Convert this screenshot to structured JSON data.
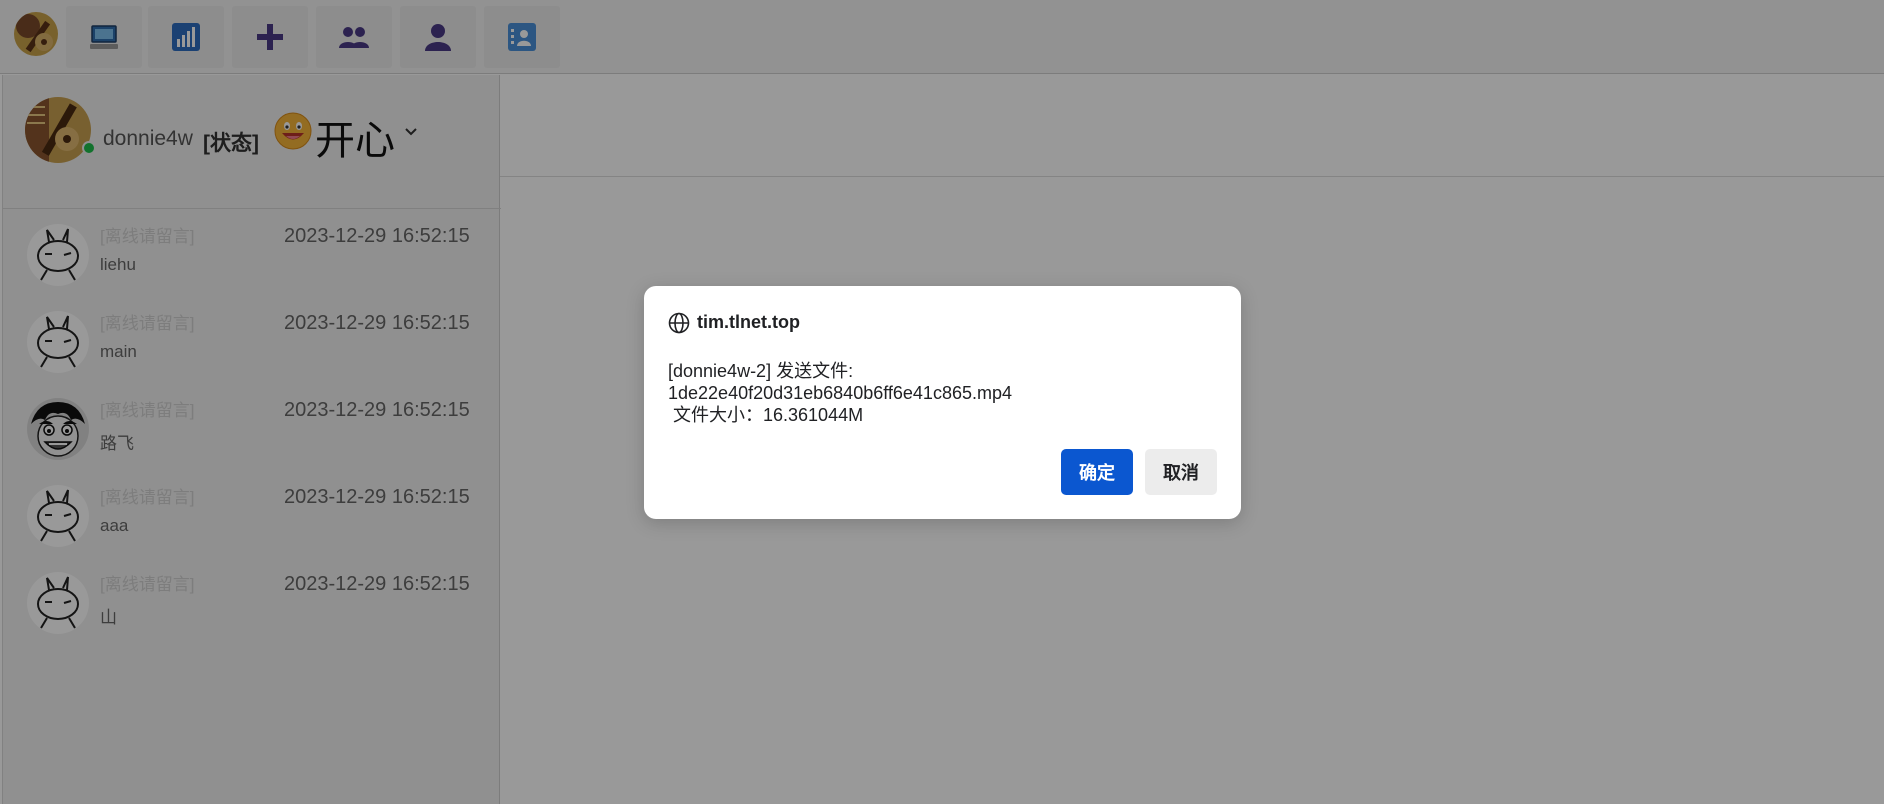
{
  "toolbar": {
    "buttons": [
      {
        "icon": "computer-icon"
      },
      {
        "icon": "bar-chart-icon"
      },
      {
        "icon": "plus-icon"
      },
      {
        "icon": "group-icon"
      },
      {
        "icon": "user-icon"
      },
      {
        "icon": "contact-card-icon"
      }
    ],
    "icon_color": "#4a3a86"
  },
  "profile": {
    "username": "donnie4w",
    "status_label": "[状态]",
    "mood": "开心",
    "online_color": "#1fbf4b"
  },
  "chats": [
    {
      "hint": "[离线请留言]",
      "name": "liehu",
      "time": "2023-12-29 16:52:15",
      "avatar": "rabbit-avatar"
    },
    {
      "hint": "[离线请留言]",
      "name": "main",
      "time": "2023-12-29 16:52:15",
      "avatar": "rabbit-avatar"
    },
    {
      "hint": "[离线请留言]",
      "name": "路飞",
      "time": "2023-12-29 16:52:15",
      "avatar": "luffy-avatar"
    },
    {
      "hint": "[离线请留言]",
      "name": "aaa",
      "time": "2023-12-29 16:52:15",
      "avatar": "rabbit-avatar"
    },
    {
      "hint": "[离线请留言]",
      "name": "山",
      "time": "2023-12-29 16:52:15",
      "avatar": "rabbit-avatar"
    }
  ],
  "dialog": {
    "origin": "tim.tlnet.top",
    "message_lines": [
      "[donnie4w-2] 发送文件:",
      "1de22e40f20d31eb6840b6ff6e41c865.mp4",
      " 文件大小：16.361044M"
    ],
    "ok_label": "确定",
    "cancel_label": "取消",
    "accent_color": "#0b57d0"
  }
}
